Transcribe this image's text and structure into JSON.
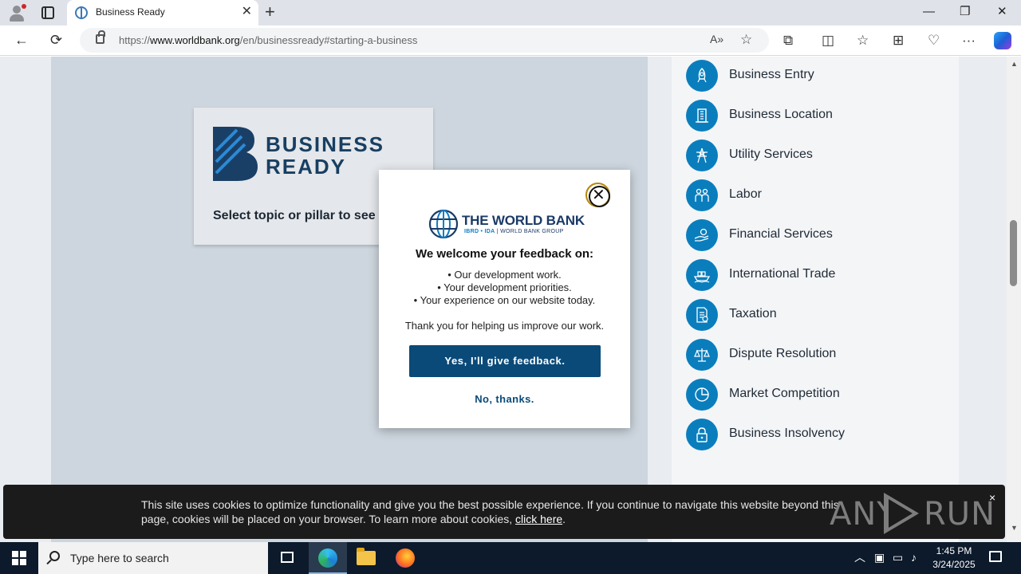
{
  "browser": {
    "tab_title": "Business Ready",
    "tab_close": "✕",
    "new_tab": "+",
    "url_scheme": "https://",
    "url_domain": "www.worldbank.org",
    "url_path": "/en/businessready#starting-a-business",
    "read_aloud": "A»",
    "favorite": "☆",
    "minimize": "—",
    "restore": "❐",
    "close": "✕",
    "back": "←",
    "refresh": "⟳",
    "extensions": "⧉",
    "split": "◫",
    "favorites": "☆",
    "collections": "⊞",
    "performance": "♡",
    "menu": "···"
  },
  "page": {
    "brand": {
      "line1": "BUSINESS",
      "line2": "READY",
      "prompt": "Select topic or pillar to see data"
    },
    "topics": [
      {
        "label": "Business Entry",
        "icon": "rocket-icon"
      },
      {
        "label": "Business Location",
        "icon": "building-icon"
      },
      {
        "label": "Utility Services",
        "icon": "power-tower-icon"
      },
      {
        "label": "Labor",
        "icon": "workers-icon"
      },
      {
        "label": "Financial Services",
        "icon": "hand-money-icon"
      },
      {
        "label": "International Trade",
        "icon": "ship-icon"
      },
      {
        "label": "Taxation",
        "icon": "tax-document-icon"
      },
      {
        "label": "Dispute Resolution",
        "icon": "scales-icon"
      },
      {
        "label": "Market Competition",
        "icon": "pie-chart-icon"
      },
      {
        "label": "Business Insolvency",
        "icon": "padlock-icon"
      }
    ]
  },
  "modal": {
    "close": "✕",
    "org_name": "THE WORLD BANK",
    "org_sub_blue": "IBRD • IDA",
    "org_sub": "| WORLD BANK GROUP",
    "heading": "We welcome your feedback on:",
    "items": [
      "• Our development work.",
      "• Your development priorities.",
      "• Your experience on our website today."
    ],
    "thanks": "Thank you for helping us improve our work.",
    "yes_label": "Yes, I'll give feedback.",
    "no_label": "No, thanks."
  },
  "cookie": {
    "text": "This site uses cookies to optimize functionality and give you the best possible experience. If you continue to navigate this website beyond this page, cookies will be placed on your browser. To learn more about cookies,",
    "link": "click here",
    "suffix": ".",
    "close": "×"
  },
  "watermark": {
    "left": "ANY",
    "right": "RUN"
  },
  "taskbar": {
    "search_placeholder": "Type here to search",
    "time": "1:45 PM",
    "date": "3/24/2025",
    "tray_chevron": "︿"
  },
  "colors": {
    "accent": "#0a7ebd",
    "button": "#0a4a79",
    "brand_navy": "#183f62"
  }
}
